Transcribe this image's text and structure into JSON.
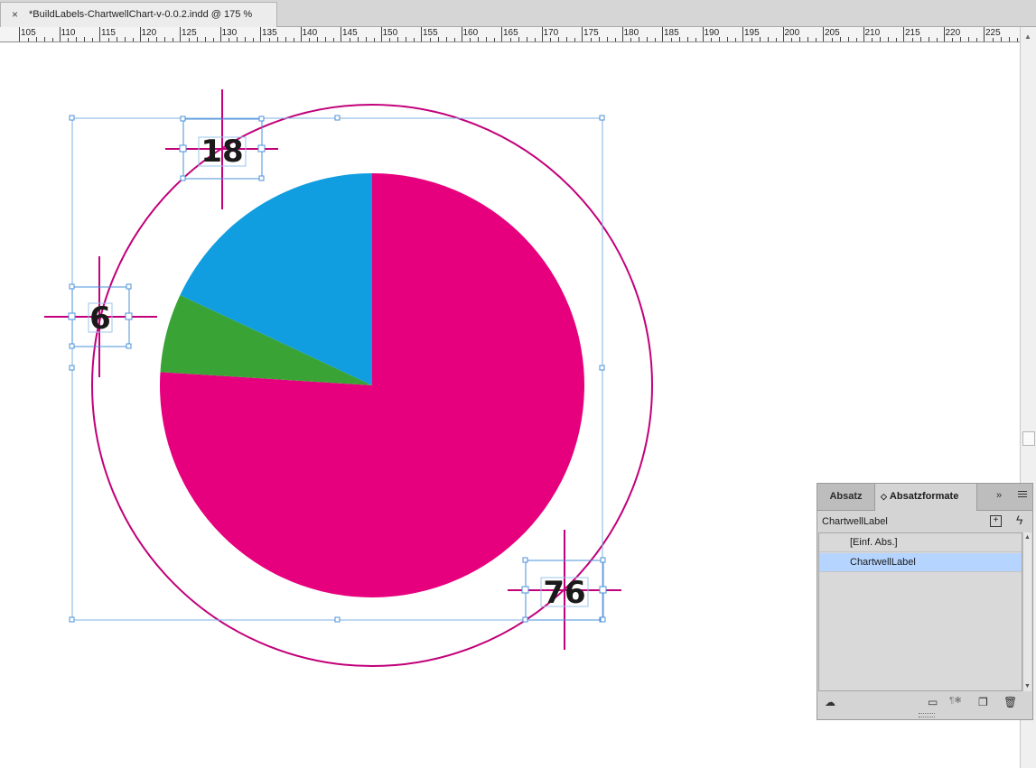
{
  "document_tab": {
    "close_glyph": "×",
    "title": "*BuildLabels-ChartwellChart-v-0.0.2.indd @ 175 %"
  },
  "ruler": {
    "labels": [
      "105",
      "110",
      "115",
      "120",
      "125",
      "130",
      "135",
      "140",
      "145",
      "150",
      "155",
      "160",
      "165",
      "170",
      "175",
      "180",
      "185",
      "190",
      "195",
      "200",
      "205",
      "210",
      "215",
      "220",
      "225"
    ]
  },
  "chart_data": {
    "type": "pie",
    "slices": [
      {
        "value": 76,
        "color": "#e6007e"
      },
      {
        "value": 6,
        "color": "#3aa335"
      },
      {
        "value": 18,
        "color": "#109ee0"
      }
    ],
    "data_labels": [
      "18",
      "6",
      "76"
    ]
  },
  "colors": {
    "frame_selection": "#4a90d9",
    "guide": "#c2007a",
    "panel_selected": "#b5d4ff"
  },
  "panel": {
    "tab_absatz": "Absatz",
    "tab_formate_arrows": "◇",
    "tab_formate": "Absatzformate",
    "expand_glyph": "»",
    "current_style": "ChartwellLabel",
    "new_style_glyph": "+",
    "quick_apply_glyph": "ϟ",
    "styles": [
      "[Einf. Abs.]",
      "ChartwellLabel"
    ],
    "selected_index": 1,
    "footer_icons": [
      "cloud-icon",
      "folder-icon",
      "clear-override-icon",
      "new-style-icon",
      "trash-icon"
    ]
  }
}
